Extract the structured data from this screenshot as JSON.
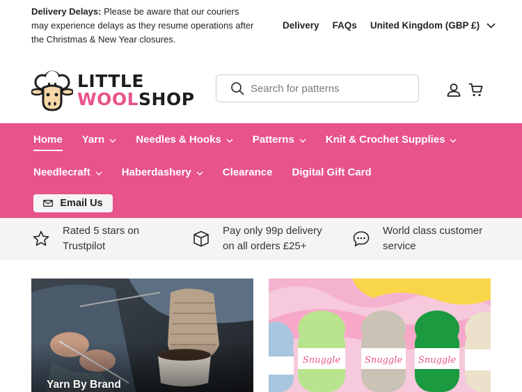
{
  "announcement": {
    "heading": "Delivery Delays:",
    "text": "Please be aware that our couriers may experience delays as they resume operations after the Christmas & New Year closures."
  },
  "top_links": {
    "delivery": "Delivery",
    "faqs": "FAQs",
    "region": "United Kingdom (GBP £)"
  },
  "logo": {
    "line1": "LITTLE",
    "line2_pink": "WOOL",
    "line2_dark": "SHOP"
  },
  "search": {
    "placeholder": "Search for patterns",
    "icon": "search-icon"
  },
  "header_icons": [
    "account-icon",
    "cart-icon"
  ],
  "nav": {
    "items_row1": [
      {
        "label": "Home",
        "has_dropdown": false,
        "active": true
      },
      {
        "label": "Yarn",
        "has_dropdown": true
      },
      {
        "label": "Needles & Hooks",
        "has_dropdown": true
      },
      {
        "label": "Patterns",
        "has_dropdown": true
      },
      {
        "label": "Knit & Crochet Supplies",
        "has_dropdown": true
      }
    ],
    "items_row2": [
      {
        "label": "Needlecraft",
        "has_dropdown": true
      },
      {
        "label": "Haberdashery",
        "has_dropdown": true
      },
      {
        "label": "Clearance",
        "has_dropdown": false
      },
      {
        "label": "Digital Gift Card",
        "has_dropdown": false
      }
    ],
    "email_button": "Email Us"
  },
  "features": [
    {
      "icon": "star-icon",
      "line1": "Rated 5 stars on",
      "line2": "Trustpilot"
    },
    {
      "icon": "box-icon",
      "line1": "Pay only 99p delivery",
      "line2": "on all orders £25+"
    },
    {
      "icon": "chat-icon",
      "line1": "World class customer",
      "line2": "service"
    }
  ],
  "cards": [
    {
      "label": "Yarn By Brand"
    },
    {
      "label": ""
    }
  ],
  "colors": {
    "brand_pink": "#e7538a",
    "feature_bg": "#f4f4f4",
    "text": "#222222"
  }
}
